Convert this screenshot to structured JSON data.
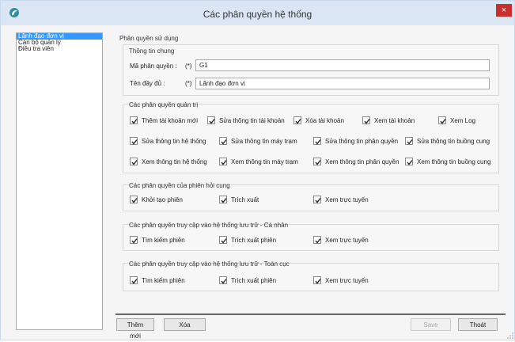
{
  "window": {
    "title": "Các phân quyền hệ thống",
    "close_label": "×"
  },
  "sidebar": {
    "items": [
      "Lãnh đạo đơn vị",
      "Cán bộ quản lý",
      "Điều tra viên"
    ]
  },
  "form": {
    "section_title": "Phân quyền sử dụng",
    "general": {
      "title": "Thông tin chung",
      "code_label": "Mã phân quyền :",
      "code_required": "(*)",
      "code_value": "G1",
      "name_label": "Tên đầy đủ :",
      "name_required": "(*)",
      "name_value": "Lãnh đạo đơn vị"
    },
    "admin": {
      "title": "Các phân quyền quản trị",
      "row1": [
        "Thêm tài khoản mới",
        "Sửa thông tin tài khoản",
        "Xóa tài khoản",
        "Xem tài khoản",
        "Xem Log"
      ],
      "row2": [
        "Sửa thông tin hệ thống",
        "Sửa thông tin máy trạm",
        "Sửa thông tin phân quyền",
        "Sửa thông tin buồng cung"
      ],
      "row3": [
        "Xem thông tin hệ thống",
        "Xem thông tin máy trạm",
        "Xem thông tin phân quyền",
        "Xem thông tin buồng cung"
      ]
    },
    "session": {
      "title": "Các phân quyền của phiên hỏi cung",
      "items": [
        "Khởi tạo phiên",
        "Trích xuất",
        "Xem trực tuyến"
      ]
    },
    "personal": {
      "title": "Các phân quyền truy cập vào hệ thống lưu trữ - Cá nhân",
      "items": [
        "Tìm kiếm phiên",
        "Trích xuất phiên",
        "Xem trực tuyến"
      ]
    },
    "global": {
      "title": "Các phân quyền truy cập vào hệ thống lưu trữ - Toàn cục",
      "items": [
        "Tìm kiếm phiên",
        "Trích xuất phiên",
        "Xem trực tuyến"
      ]
    }
  },
  "buttons": {
    "add": "Thêm mới",
    "delete": "Xóa",
    "save": "Save",
    "exit": "Thoát"
  },
  "colors": {
    "titlebar": "#dbe6f4",
    "selected": "#3399ff",
    "close": "#c9302c"
  }
}
